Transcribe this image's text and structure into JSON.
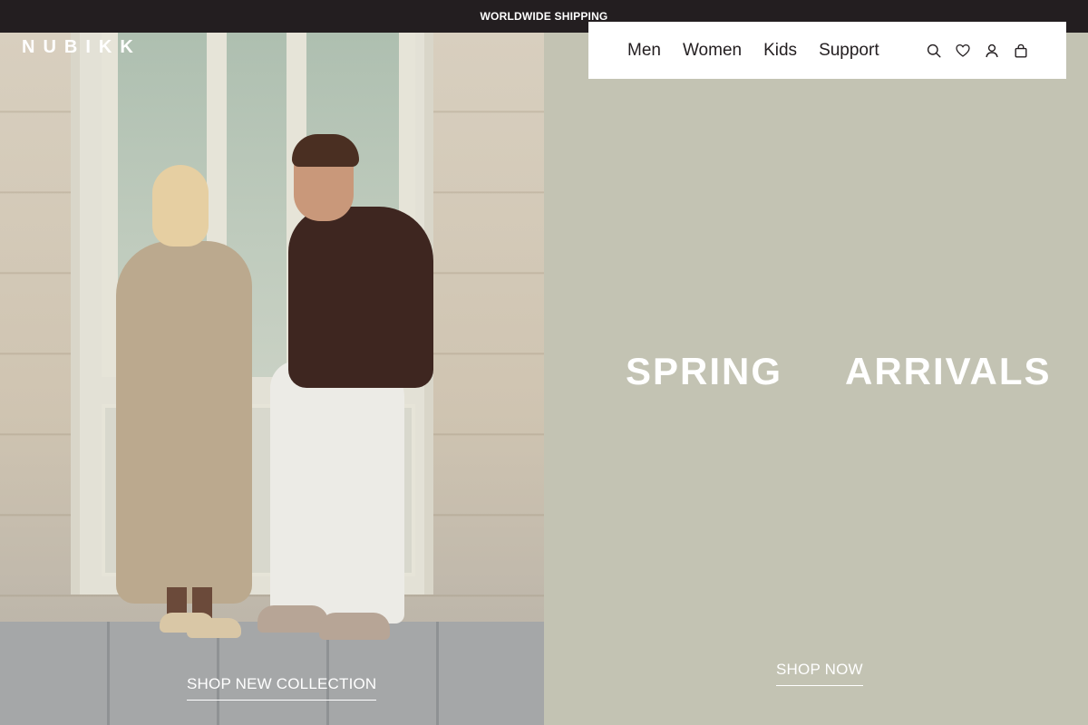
{
  "announcement": {
    "text": "WORLDWIDE SHIPPING"
  },
  "brand": {
    "logo_text": "NUBIKK"
  },
  "nav": {
    "links": [
      {
        "label": "Men"
      },
      {
        "label": "Women"
      },
      {
        "label": "Kids"
      },
      {
        "label": "Support"
      }
    ],
    "icons": [
      "search-icon",
      "heart-icon",
      "account-icon",
      "bag-icon"
    ]
  },
  "hero_left": {
    "image": "photo-couple-in-front-of-door",
    "cta_label": "SHOP NEW COLLECTION"
  },
  "hero_right": {
    "title_word_1": "SPRING",
    "title_word_2": "ARRIVALS",
    "cta_label": "SHOP NOW"
  },
  "colors": {
    "announcement_bg": "#231e20",
    "panel_bg": "#c3c3b3",
    "text_light": "#ffffff",
    "text_dark": "#231e20"
  }
}
